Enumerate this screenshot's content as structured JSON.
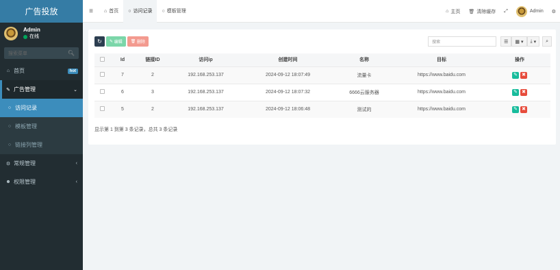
{
  "app": {
    "brand": "广告投放"
  },
  "user": {
    "name": "Admin",
    "status": "在线"
  },
  "sidebar": {
    "search_placeholder": "搜索菜单",
    "items": [
      {
        "icon": "home-icon",
        "label": "首页",
        "badge": "hot"
      },
      {
        "icon": "ad-icon",
        "label": "广告管理",
        "open": true
      },
      {
        "icon": "circle-icon",
        "label": "访问记录",
        "sub": true,
        "active": true
      },
      {
        "icon": "circle-icon",
        "label": "模板管理",
        "sub": true
      },
      {
        "icon": "circle-icon",
        "label": "链接列管理",
        "sub": true
      },
      {
        "icon": "gears-icon",
        "label": "常规管理"
      },
      {
        "icon": "group-icon",
        "label": "权限管理"
      }
    ]
  },
  "topbar": {
    "tabs": [
      {
        "label": "首页",
        "icon": "home-icon"
      },
      {
        "label": "访问记录",
        "icon": "circle-icon",
        "active": true
      },
      {
        "label": "模板管理",
        "icon": "circle-icon"
      }
    ],
    "right": {
      "home": "主页",
      "clear_cache": "清除缓存",
      "user": "Admin"
    }
  },
  "toolbar": {
    "edit_label": "编辑",
    "delete_label": "删除",
    "search_placeholder": "搜索"
  },
  "table": {
    "columns": [
      "Id",
      "链接ID",
      "访问ip",
      "创建时间",
      "名称",
      "目标",
      "操作"
    ],
    "rows": [
      {
        "id": "7",
        "link_id": "2",
        "ip": "192.168.253.137",
        "created": "2024-09-12 18:07:49",
        "name": "流量卡",
        "target": "https://www.baidu.com"
      },
      {
        "id": "6",
        "link_id": "3",
        "ip": "192.168.253.137",
        "created": "2024-09-12 18:07:32",
        "name": "6666云服务器",
        "target": "https://www.baidu.com"
      },
      {
        "id": "5",
        "link_id": "2",
        "ip": "192.168.253.137",
        "created": "2024-09-12 18:06:48",
        "name": "测试的",
        "target": "https://www.baidu.com"
      }
    ],
    "footer": "显示第 1 到第 3 条记录，总共 3 条记录"
  },
  "colors": {
    "sidebar_bg": "#222d32",
    "brand_bg": "#357ca5",
    "accent": "#3c8dbc",
    "success": "#18bc9c",
    "danger": "#e74c3c"
  }
}
